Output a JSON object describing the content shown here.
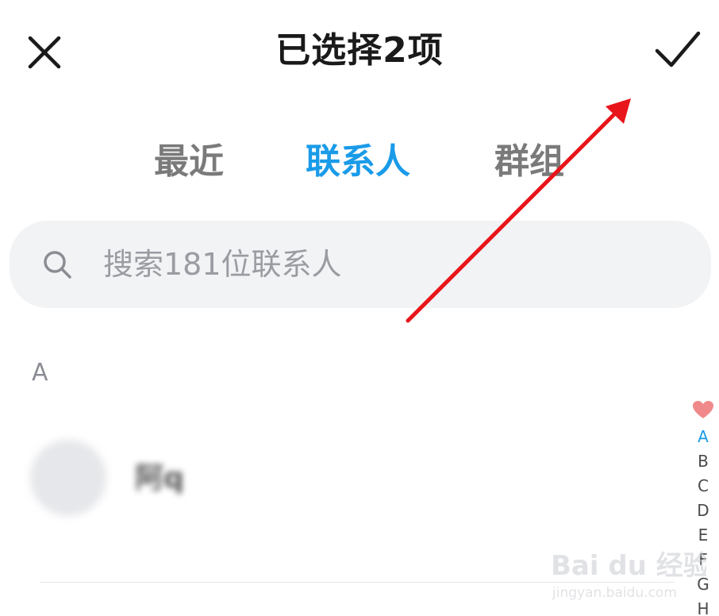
{
  "header": {
    "title": "已选择2项",
    "close_icon": "close-icon",
    "confirm_icon": "checkmark-icon"
  },
  "tabs": [
    {
      "label": "最近",
      "active": false
    },
    {
      "label": "联系人",
      "active": true
    },
    {
      "label": "群组",
      "active": false
    }
  ],
  "search": {
    "icon": "search-icon",
    "placeholder": "搜索181位联系人"
  },
  "contacts": {
    "section": "A",
    "items": [
      {
        "name": "阿q"
      }
    ]
  },
  "index_bar": {
    "favorite_icon": "heart-icon",
    "letters": [
      "A",
      "B",
      "C",
      "D",
      "E",
      "F",
      "G",
      "H"
    ],
    "active": "A"
  },
  "watermark": {
    "brand": "Bai du 经验",
    "url": "jingyan.baidu.com"
  },
  "colors": {
    "accent": "#1a9be8",
    "annotation_arrow": "#e8151b",
    "heart": "#f08a8a"
  }
}
